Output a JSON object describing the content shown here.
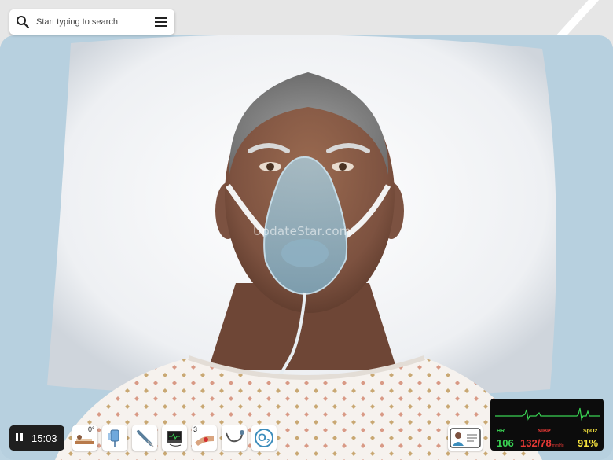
{
  "search": {
    "placeholder": "Start typing to search"
  },
  "watermark": "UpdateStar.com",
  "timer": {
    "value": "15:03"
  },
  "toolbar": {
    "items": [
      {
        "name": "bed-position",
        "badge": "0°"
      },
      {
        "name": "iv-fluids"
      },
      {
        "name": "syringe"
      },
      {
        "name": "ecg-monitor"
      },
      {
        "name": "blood-pressure-cuff",
        "badge": "3"
      },
      {
        "name": "stethoscope"
      },
      {
        "name": "oxygen",
        "label": "O",
        "sub": "2"
      }
    ]
  },
  "monitor": {
    "hr": {
      "label": "HR",
      "value": "106",
      "color": "#39d353"
    },
    "nibp": {
      "label": "NIBP",
      "value": "132/78",
      "unit": "mmHg",
      "color": "#e53935"
    },
    "spo2": {
      "label": "SpO2",
      "value": "91%",
      "color": "#f5e23c"
    }
  }
}
